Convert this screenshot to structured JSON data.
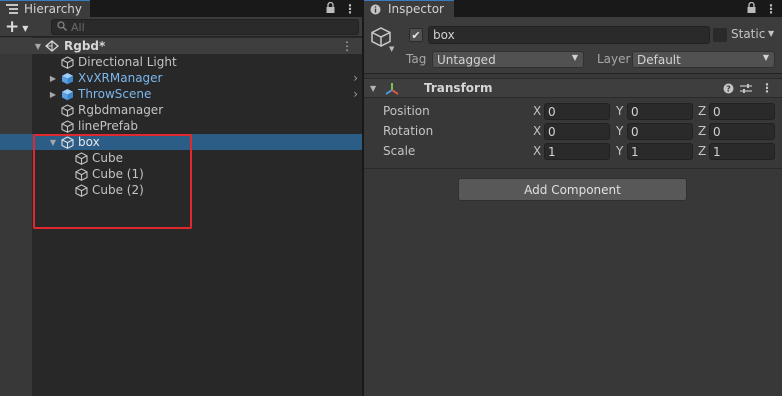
{
  "hierarchy": {
    "tab_label": "Hierarchy",
    "search_placeholder": "All",
    "scene": {
      "name": "Rgbd*"
    },
    "items": [
      {
        "label": "Directional Light",
        "kind": "gameobject"
      },
      {
        "label": "XvXRManager",
        "kind": "prefab"
      },
      {
        "label": "ThrowScene",
        "kind": "prefab"
      },
      {
        "label": "Rgbdmanager",
        "kind": "gameobject"
      },
      {
        "label": "linePrefab",
        "kind": "gameobject"
      },
      {
        "label": "box",
        "kind": "gameobject",
        "selected": true,
        "expanded": true,
        "children": [
          {
            "label": "Cube"
          },
          {
            "label": "Cube (1)"
          },
          {
            "label": "Cube (2)"
          }
        ]
      }
    ]
  },
  "inspector": {
    "tab_label": "Inspector",
    "object_name": "box",
    "active": true,
    "static_label": "Static",
    "tag_label": "Tag",
    "tag_value": "Untagged",
    "layer_label": "Layer",
    "layer_value": "Default",
    "component": {
      "title": "Transform",
      "rows": [
        {
          "label": "Position",
          "x": "0",
          "y": "0",
          "z": "0"
        },
        {
          "label": "Rotation",
          "x": "0",
          "y": "0",
          "z": "0"
        },
        {
          "label": "Scale",
          "x": "1",
          "y": "1",
          "z": "1"
        }
      ],
      "axis_labels": {
        "x": "X",
        "y": "Y",
        "z": "Z"
      }
    },
    "add_component_label": "Add Component"
  },
  "colors": {
    "selection": "#2c5d87",
    "prefab_text": "#7bb7ed",
    "annotation": "#e0282d"
  }
}
